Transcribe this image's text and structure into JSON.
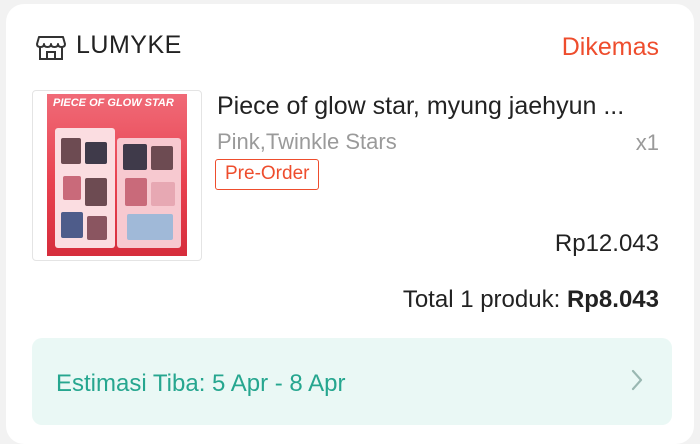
{
  "shop": {
    "icon": "store-icon",
    "name": "LUMYKE",
    "status": "Dikemas",
    "status_color": "#ee4d2d"
  },
  "product": {
    "thumbnail_text": "PIECE OF GLOW STAR",
    "name": "Piece of glow star, myung jaehyun ...",
    "variant": "Pink,Twinkle Stars",
    "quantity": "x1",
    "badge": "Pre-Order",
    "price": "Rp12.043"
  },
  "summary": {
    "total_label": "Total 1 produk: ",
    "total_value": "Rp8.043"
  },
  "delivery": {
    "estimate": "Estimasi Tiba: 5 Apr - 8 Apr",
    "estimate_color": "#26a68f",
    "chevron_icon": "chevron-right-icon"
  }
}
